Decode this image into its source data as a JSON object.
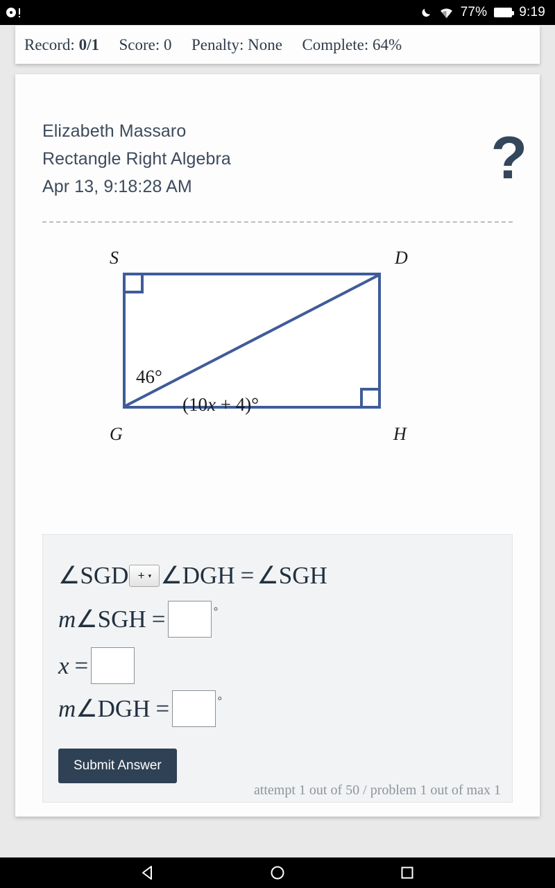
{
  "status_bar": {
    "notification_icon": "notification-disc-icon",
    "dnd_icon": "moon-icon",
    "wifi_icon": "wifi-icon",
    "battery_percent": "77%",
    "battery_icon": "battery-icon",
    "clock": "9:19"
  },
  "score_bar": {
    "record_label": "Record:",
    "record_value": "0/1",
    "score_label": "Score:",
    "score_value": "0",
    "penalty_label": "Penalty:",
    "penalty_value": "None",
    "complete_label": "Complete:",
    "complete_value": "64%"
  },
  "header": {
    "student_name": "Elizabeth Massaro",
    "assignment_title": "Rectangle Right Algebra",
    "timestamp": "Apr 13, 9:18:28 AM",
    "help_icon": "?"
  },
  "figure": {
    "vertex_top_left": "S",
    "vertex_top_right": "D",
    "vertex_bottom_left": "G",
    "vertex_bottom_right": "H",
    "angle_label_left": "46°",
    "angle_label_bottom_prefix": "(10",
    "angle_label_bottom_var": "x",
    "angle_label_bottom_suffix": " + 4)°",
    "stroke_color": "#3f5c9a",
    "right_angle_marks": [
      "top-left",
      "bottom-right"
    ]
  },
  "answer_panel": {
    "equation": {
      "term1": "∠SGD",
      "operator_value": "+",
      "operator_caret": "▾",
      "term2": "∠DGH",
      "equals": "=",
      "term3": "∠SGH"
    },
    "row_sgh": {
      "prefix_m": "m",
      "angle": "∠SGH",
      "equals": "=",
      "value": "",
      "unit": "◦"
    },
    "row_x": {
      "variable": "x",
      "equals": "=",
      "value": ""
    },
    "row_dgh": {
      "prefix_m": "m",
      "angle": "∠DGH",
      "equals": "=",
      "value": "",
      "unit": "◦"
    },
    "submit_label": "Submit Answer",
    "attempt_text": "attempt 1 out of 50 / problem 1 out of max 1"
  },
  "nav_bar": {
    "back_icon": "back-triangle-icon",
    "home_icon": "home-circle-icon",
    "recents_icon": "recents-square-icon"
  }
}
